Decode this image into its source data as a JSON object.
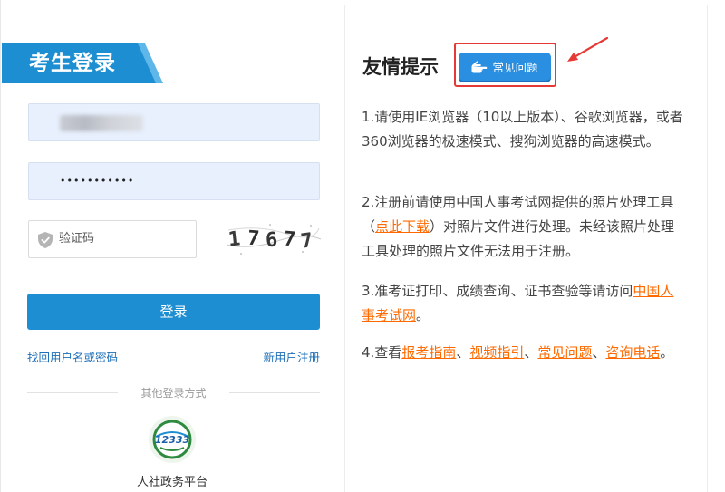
{
  "login": {
    "title": "考生登录",
    "password_mask": "•••••••••••",
    "captcha_placeholder": "验证码",
    "captcha_code": [
      "1",
      "7",
      "6",
      "7",
      "7"
    ],
    "login_button": "登录",
    "forgot_link": "找回用户名或密码",
    "register_link": "新用户注册",
    "other_methods": "其他登录方式",
    "platform_badge": "12333",
    "platform_label": "人社政务平台"
  },
  "tips": {
    "title": "友情提示",
    "faq_button": "常见问题",
    "tip1": "1.请使用IE浏览器（10以上版本）、谷歌浏览器，或者360浏览器的极速模式、搜狗浏览器的高速模式。",
    "tip2_before": "2.注册前请使用中国人事考试网提供的照片处理工具（",
    "tip2_link": "点此下载",
    "tip2_after": "）对照片文件进行处理。未经该照片处理工具处理的照片文件无法用于注册。",
    "tip3_before": "3.准考证打印、成绩查询、证书查验等请访问",
    "tip3_link": "中国人事考试网",
    "tip3_after": "。",
    "tip4_before": "4.查看",
    "tip4_link1": "报考指南",
    "tip4_sep1": "、",
    "tip4_link2": "视频指引",
    "tip4_sep2": "、",
    "tip4_link3": "常见问题",
    "tip4_sep3": "、",
    "tip4_link4": "咨询电话",
    "tip4_after": "。"
  },
  "colors": {
    "primary_blue": "#1d8ed1",
    "link_blue": "#1d6fb8",
    "link_orange": "#ff6a00",
    "highlight_red": "#e53935"
  }
}
